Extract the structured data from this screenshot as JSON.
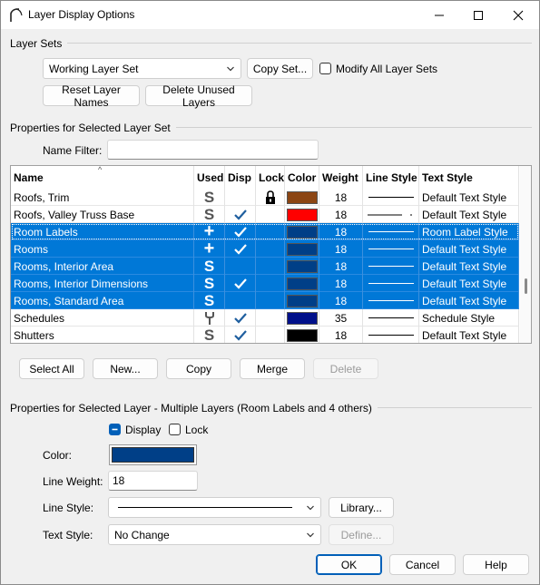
{
  "window": {
    "title": "Layer Display Options"
  },
  "layer_sets": {
    "group_label": "Layer Sets",
    "selected_set": "Working Layer Set",
    "copy_set_label": "Copy Set...",
    "modify_all_label": "Modify All Layer Sets",
    "modify_all_checked": false,
    "reset_names_label": "Reset Layer Names",
    "delete_unused_label": "Delete Unused Layers"
  },
  "props_set": {
    "group_label": "Properties for Selected Layer Set",
    "name_filter_label": "Name Filter:",
    "name_filter_value": ""
  },
  "table": {
    "headers": {
      "name": "Name",
      "used": "Used",
      "disp": "Disp",
      "lock": "Lock",
      "color": "Color",
      "weight": "Weight",
      "line_style": "Line Style",
      "text_style": "Text Style"
    },
    "sort_indicator": "^",
    "rows": [
      {
        "name": "Roofs, Trim",
        "used": "S",
        "disp": false,
        "lock": true,
        "color": "#8b4513",
        "weight": "18",
        "line": "solid",
        "text_style": "Default Text Style",
        "selected": false
      },
      {
        "name": "Roofs, Valley Truss Base",
        "used": "S",
        "disp": true,
        "lock": false,
        "color": "#ff0000",
        "weight": "18",
        "line": "dash-dot",
        "text_style": "Default Text Style",
        "selected": false
      },
      {
        "name": "Room Labels",
        "used": "+",
        "disp": true,
        "lock": false,
        "color": "#003f87",
        "weight": "18",
        "line": "solid",
        "text_style": "Room Label Style",
        "selected": true
      },
      {
        "name": "Rooms",
        "used": "+",
        "disp": true,
        "lock": false,
        "color": "#003f87",
        "weight": "18",
        "line": "solid",
        "text_style": "Default Text Style",
        "selected": true
      },
      {
        "name": "Rooms, Interior Area",
        "used": "S",
        "disp": false,
        "lock": false,
        "color": "#003f87",
        "weight": "18",
        "line": "solid",
        "text_style": "Default Text Style",
        "selected": true
      },
      {
        "name": "Rooms, Interior Dimensions",
        "used": "S",
        "disp": true,
        "lock": false,
        "color": "#003f87",
        "weight": "18",
        "line": "solid",
        "text_style": "Default Text Style",
        "selected": true
      },
      {
        "name": "Rooms, Standard Area",
        "used": "S",
        "disp": false,
        "lock": false,
        "color": "#003f87",
        "weight": "18",
        "line": "solid",
        "text_style": "Default Text Style",
        "selected": true
      },
      {
        "name": "Schedules",
        "used": "wrench",
        "disp": true,
        "lock": false,
        "color": "#00108a",
        "weight": "35",
        "line": "solid",
        "text_style": "Schedule Style",
        "selected": false
      },
      {
        "name": "Shutters",
        "used": "S",
        "disp": true,
        "lock": false,
        "color": "#000000",
        "weight": "18",
        "line": "solid",
        "text_style": "Default Text Style",
        "selected": false
      }
    ]
  },
  "table_buttons": {
    "select_all": "Select All",
    "new": "New...",
    "copy": "Copy",
    "merge": "Merge",
    "delete": "Delete"
  },
  "props_layer": {
    "group_label": "Properties for Selected Layer - Multiple Layers (Room Labels and 4 others)",
    "display_label": "Display",
    "display_checked": "mixed",
    "lock_label": "Lock",
    "lock_checked": false,
    "color_label": "Color:",
    "color_value": "#003f87",
    "line_weight_label": "Line Weight:",
    "line_weight_value": "18",
    "line_style_label": "Line Style:",
    "library_label": "Library...",
    "text_style_label": "Text Style:",
    "text_style_value": "No Change",
    "define_label": "Define..."
  },
  "footer": {
    "ok": "OK",
    "cancel": "Cancel",
    "help": "Help"
  }
}
